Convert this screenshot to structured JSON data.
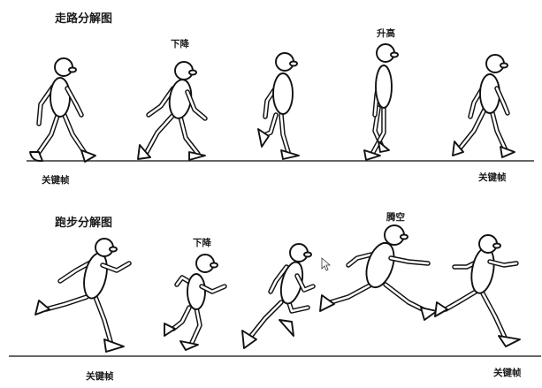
{
  "walk": {
    "title": "走路分解图",
    "label_down": "下降",
    "label_up": "升高",
    "key_left": "关键帧",
    "key_right": "关键帧"
  },
  "run": {
    "title": "跑步分解图",
    "label_down": "下降",
    "label_air": "腾空",
    "key_left": "关键帧",
    "key_right": "关键帧"
  }
}
